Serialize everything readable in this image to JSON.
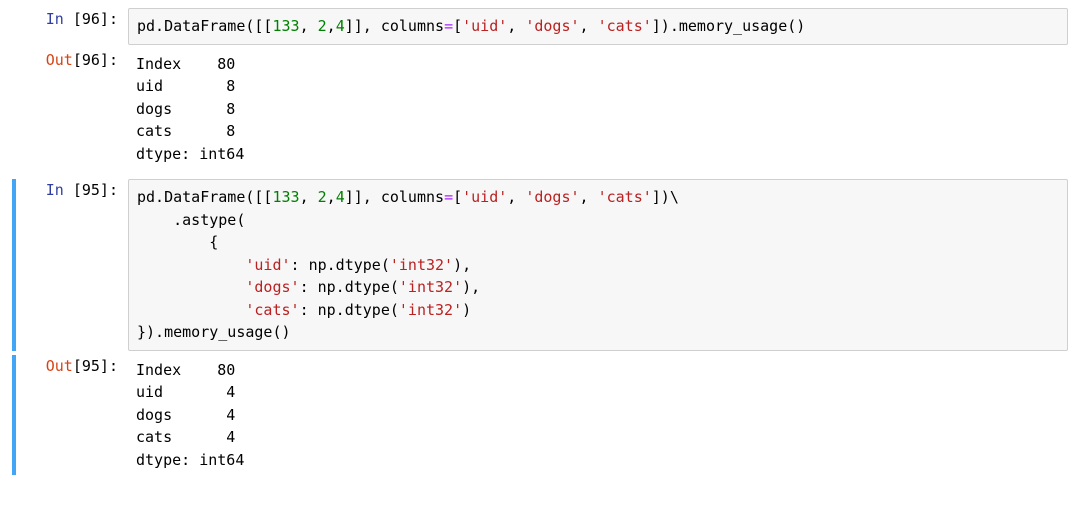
{
  "cells": {
    "0": {
      "in_label": "In ",
      "num": "[96]:",
      "code_pre": "pd.DataFrame([[",
      "n1": "133",
      "sep1": ", ",
      "n2": "2",
      "sep2": ",",
      "n3": "4",
      "mid": "]], columns",
      "eq": "=",
      "lb": "[",
      "s1": "'uid'",
      "c1": ", ",
      "s2": "'dogs'",
      "c2": ", ",
      "s3": "'cats'",
      "tail": "]).memory_usage()"
    },
    "1": {
      "out_label": "Out",
      "num": "[96]:",
      "text": "Index    80\nuid       8\ndogs      8\ncats      8\ndtype: int64"
    },
    "2": {
      "in_label": "In ",
      "num": "[95]:",
      "l1_pre": "pd.DataFrame([[",
      "l1_n1": "133",
      "l1_sep1": ", ",
      "l1_n2": "2",
      "l1_sep2": ",",
      "l1_n3": "4",
      "l1_mid": "]], columns",
      "l1_eq": "=",
      "l1_lb": "[",
      "l1_s1": "'uid'",
      "l1_c1": ", ",
      "l1_s2": "'dogs'",
      "l1_c2": ", ",
      "l1_s3": "'cats'",
      "l1_tail": "])\\",
      "l2": "    .astype(",
      "l3": "        {",
      "l4_pre": "            ",
      "l4_s": "'uid'",
      "l4_mid": ": np.dtype(",
      "l4_s2": "'int32'",
      "l4_tail": "),",
      "l5_pre": "            ",
      "l5_s": "'dogs'",
      "l5_mid": ": np.dtype(",
      "l5_s2": "'int32'",
      "l5_tail": "),",
      "l6_pre": "            ",
      "l6_s": "'cats'",
      "l6_mid": ": np.dtype(",
      "l6_s2": "'int32'",
      "l6_tail": ")",
      "l7": "}).memory_usage()"
    },
    "3": {
      "out_label": "Out",
      "num": "[95]:",
      "text": "Index    80\nuid       4\ndogs      4\ncats      4\ndtype: int64"
    }
  }
}
